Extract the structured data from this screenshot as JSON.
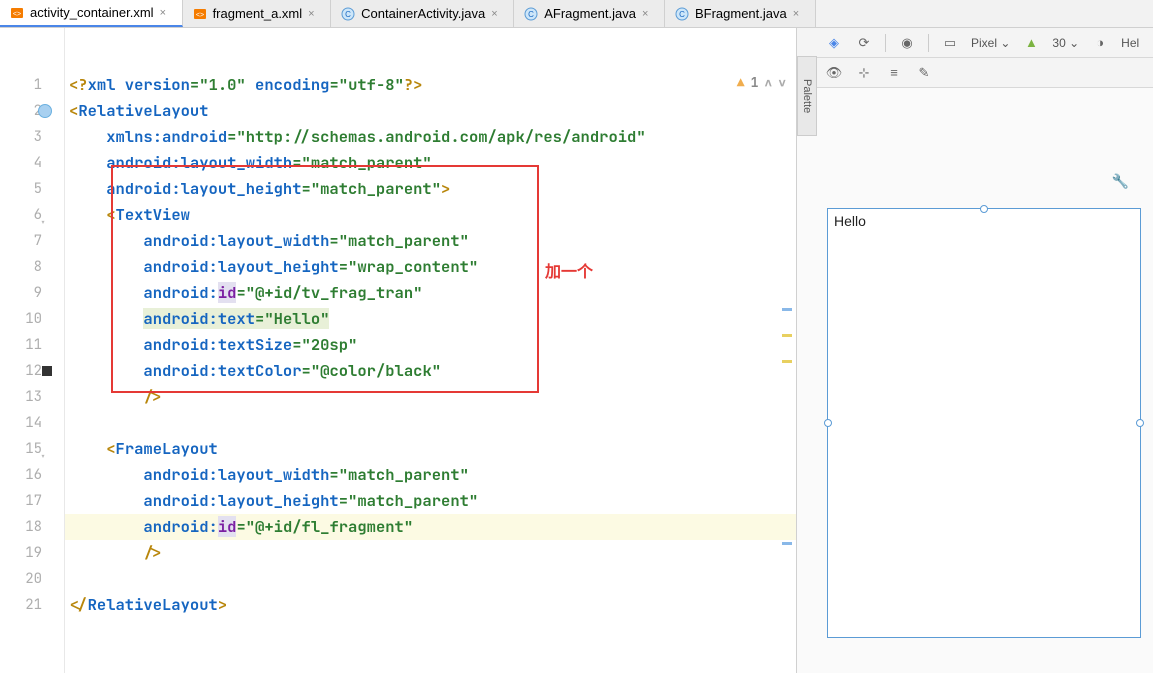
{
  "tabs": [
    {
      "label": "activity_container.xml",
      "icon": "xml",
      "active": true
    },
    {
      "label": "fragment_a.xml",
      "icon": "xml",
      "active": false
    },
    {
      "label": "ContainerActivity.java",
      "icon": "java",
      "active": false
    },
    {
      "label": "AFragment.java",
      "icon": "java",
      "active": false
    },
    {
      "label": "BFragment.java",
      "icon": "java",
      "active": false
    }
  ],
  "gutter_lines": [
    "1",
    "2",
    "3",
    "4",
    "5",
    "6",
    "7",
    "8",
    "9",
    "10",
    "11",
    "12",
    "13",
    "14",
    "15",
    "16",
    "17",
    "18",
    "19",
    "20",
    "21"
  ],
  "code": {
    "l1_a": "<?",
    "l1_b": "xml version",
    "l1_c": "=",
    "l1_d": "\"1.0\"",
    "l1_e": " encoding",
    "l1_f": "=",
    "l1_g": "\"utf-8\"",
    "l1_h": "?>",
    "l2_a": "<",
    "l2_b": "RelativeLayout",
    "l3_a": "    ",
    "l3_b": "xmlns:",
    "l3_c": "android",
    "l3_d": "=",
    "l3_e": "\"http://schemas.android.com/apk/res/android\"",
    "l4_a": "    ",
    "l4_b": "android",
    "l4_c": ":layout_width",
    "l4_d": "=",
    "l4_e": "\"match_parent\"",
    "l5_a": "    ",
    "l5_b": "android",
    "l5_c": ":layout_height",
    "l5_d": "=",
    "l5_e": "\"match_parent\"",
    "l5_f": ">",
    "l6_a": "    <",
    "l6_b": "TextView",
    "l7_a": "        ",
    "l7_b": "android",
    "l7_c": ":layout_width",
    "l7_d": "=",
    "l7_e": "\"match_parent\"",
    "l8_a": "        ",
    "l8_b": "android",
    "l8_c": ":layout_height",
    "l8_d": "=",
    "l8_e": "\"wrap_content\"",
    "l9_a": "        ",
    "l9_b": "android",
    "l9_c": ":",
    "l9_d": "id",
    "l9_e": "=",
    "l9_f": "\"@+id/tv_frag_tran\"",
    "l10_a": "        ",
    "l10_b": "android",
    "l10_c": ":text",
    "l10_d": "=",
    "l10_e": "\"Hello\"",
    "l11_a": "        ",
    "l11_b": "android",
    "l11_c": ":textSize",
    "l11_d": "=",
    "l11_e": "\"20sp\"",
    "l12_a": "        ",
    "l12_b": "android",
    "l12_c": ":textColor",
    "l12_d": "=",
    "l12_e": "\"@color/black\"",
    "l13_a": "        />",
    "l15_a": "    <",
    "l15_b": "FrameLayout",
    "l16_a": "        ",
    "l16_b": "android",
    "l16_c": ":layout_width",
    "l16_d": "=",
    "l16_e": "\"match_parent\"",
    "l17_a": "        ",
    "l17_b": "android",
    "l17_c": ":layout_height",
    "l17_d": "=",
    "l17_e": "\"match_parent\"",
    "l18_a": "        ",
    "l18_b": "android",
    "l18_c": ":",
    "l18_d": "id",
    "l18_e": "=",
    "l18_f": "\"@+id/fl_fragment\"",
    "l19_a": "        />",
    "l21_a": "</",
    "l21_b": "RelativeLayout",
    "l21_c": ">"
  },
  "annotation": "加一个",
  "warning_count": "1",
  "preview": {
    "palette_label": "Palette",
    "device": "Pixel",
    "api": "30",
    "theme": "Hel",
    "hello_text": "Hello"
  }
}
